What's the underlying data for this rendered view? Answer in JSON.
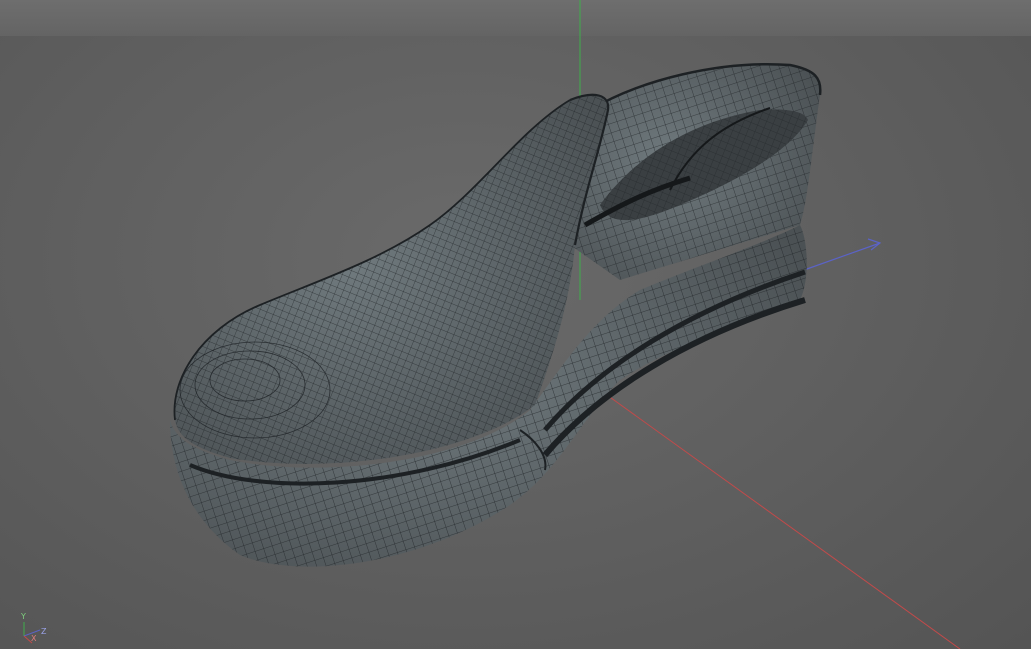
{
  "viewport": {
    "background": "#5e5e5e",
    "object": "shoe-wireframe-mesh"
  },
  "colors": {
    "mesh_fill": "#5f6669",
    "mesh_wire": "#1d2124",
    "axis_x": "#c24a4a",
    "axis_y": "#3fae4b",
    "axis_z": "#5b63c7"
  },
  "gizmo": {
    "y_label": "Y",
    "z_label": "Z",
    "x_label": "X"
  }
}
